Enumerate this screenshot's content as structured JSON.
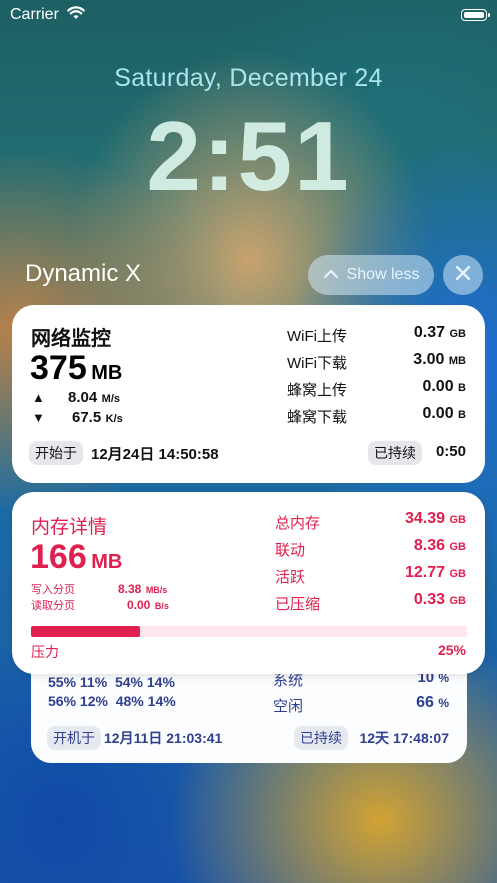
{
  "status_bar": {
    "carrier": "Carrier"
  },
  "lock": {
    "date": "Saturday, December 24",
    "time": "2:51"
  },
  "header": {
    "app_name": "Dynamic X",
    "show_less": "Show less"
  },
  "network": {
    "title": "网络监控",
    "total_value": "375",
    "total_unit": "MB",
    "up_arrow": "▲",
    "up_speed": "8.04",
    "up_unit": "M/s",
    "down_arrow": "▼",
    "down_speed": "67.5",
    "down_unit": "K/s",
    "stats": [
      {
        "label": "WiFi上传",
        "value": "0.37",
        "unit": "GB"
      },
      {
        "label": "WiFi下载",
        "value": "3.00",
        "unit": "MB"
      },
      {
        "label": "蜂窝上传",
        "value": "0.00",
        "unit": "B"
      },
      {
        "label": "蜂窝下载",
        "value": "0.00",
        "unit": "B"
      }
    ],
    "start_label": "开始于",
    "start_time": "12月24日 14:50:58",
    "duration_label": "已持续",
    "duration": "0:50"
  },
  "memory": {
    "title": "内存详情",
    "total_value": "166",
    "total_unit": "MB",
    "pagein_label": "写入分页",
    "pagein_value": "8.38",
    "pagein_unit": "MB/s",
    "pageout_label": "读取分页",
    "pageout_value": "0.00",
    "pageout_unit": "B/s",
    "stats": [
      {
        "label": "总内存",
        "value": "34.39",
        "unit": "GB"
      },
      {
        "label": "联动",
        "value": "8.36",
        "unit": "GB"
      },
      {
        "label": "活跃",
        "value": "12.77",
        "unit": "GB"
      },
      {
        "label": "已压缩",
        "value": "0.33",
        "unit": "GB"
      }
    ],
    "pressure_label": "压力",
    "pressure_text": "25%",
    "pressure_fraction": 0.25,
    "accent": "#e0204f"
  },
  "cpu": {
    "row1": [
      "55%",
      "11%",
      "54%",
      "14%"
    ],
    "row2": [
      "56%",
      "12%",
      "48%",
      "14%"
    ],
    "sys_label": "系统",
    "sys_value": "10",
    "sys_unit": "%",
    "idle_label": "空闲",
    "idle_value": "66",
    "idle_unit": "%",
    "boot_label": "开机于",
    "boot_time": "12月11日 21:03:41",
    "uptime_label": "已持续",
    "uptime": "12天 17:48:07",
    "accent": "#2f3f8f"
  }
}
